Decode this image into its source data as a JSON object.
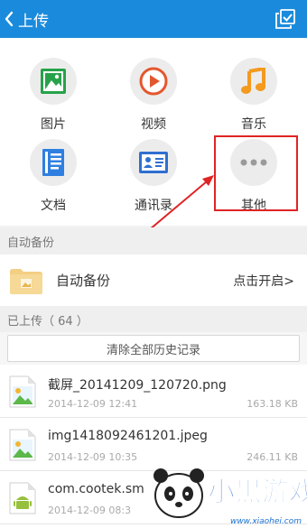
{
  "header": {
    "title": "上传",
    "back_icon": "chevron-left-icon",
    "action_icon": "select-check-icon",
    "bg": "#1a8bdc"
  },
  "categories": [
    {
      "label": "图片",
      "icon": "image-icon",
      "color": "#27a24a"
    },
    {
      "label": "视频",
      "icon": "play-icon",
      "color": "#e4572e"
    },
    {
      "label": "音乐",
      "icon": "music-icon",
      "color": "#f39a1f"
    },
    {
      "label": "文档",
      "icon": "document-icon",
      "color": "#2f7fe0"
    },
    {
      "label": "通讯录",
      "icon": "contact-card-icon",
      "color": "#2f6fd0"
    },
    {
      "label": "其他",
      "icon": "more-dots-icon",
      "color": "#9a9a9a"
    }
  ],
  "auto_backup": {
    "section_title": "自动备份",
    "label": "自动备份",
    "action": "点击开启>"
  },
  "uploaded": {
    "section_title": "已上传（ 64 ）",
    "clear_label": "清除全部历史记录"
  },
  "files": [
    {
      "name": "截屏_20141209_120720.png",
      "date": "2014-12-09 12:41",
      "size": "163.18 KB",
      "icon": "image-file-icon"
    },
    {
      "name": "img1418092461201.jpeg",
      "date": "2014-12-09 10:35",
      "size": "246.11 KB",
      "icon": "image-file-icon"
    },
    {
      "name": "com.cootek.sm",
      "date": "2014-12-09 08:3",
      "size": "",
      "icon": "android-apk-icon"
    }
  ],
  "watermark": {
    "brand": "小黑游戏",
    "url": "www.xiaohei.com"
  },
  "highlight_color": "#e02424"
}
